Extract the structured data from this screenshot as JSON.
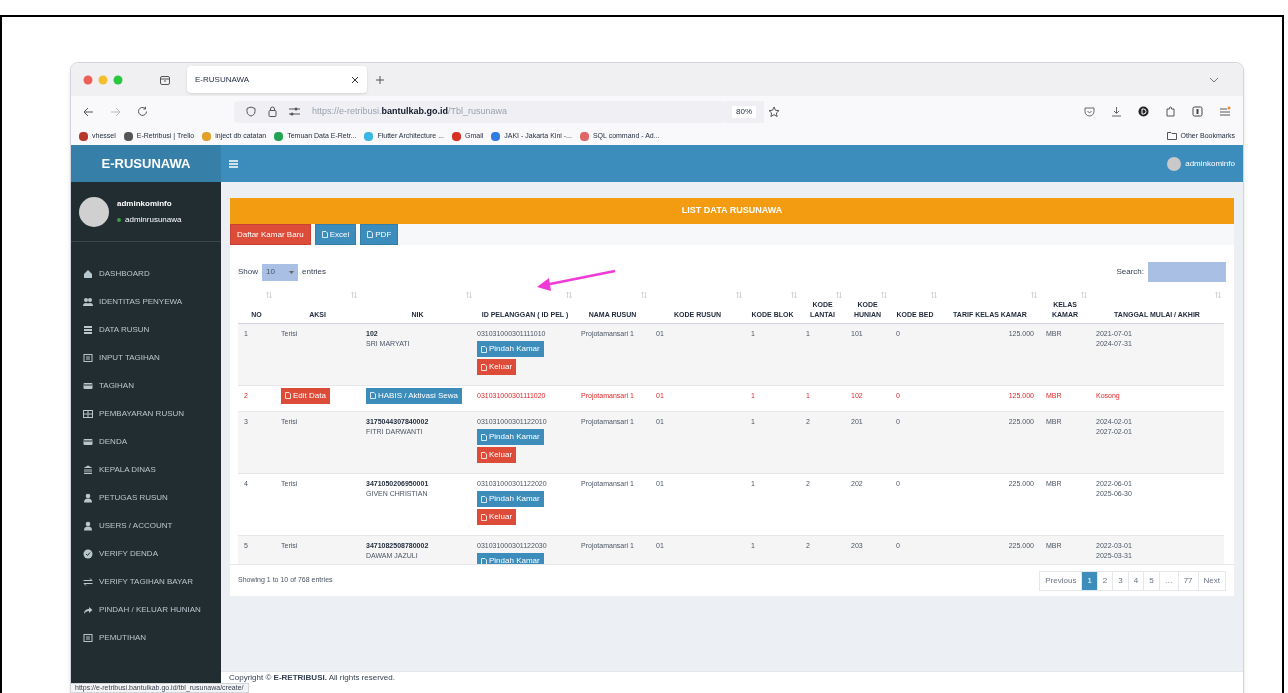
{
  "browser": {
    "tab_title": "E-RUSUNAWA",
    "url": "https://e-retribusi.**bantulkab.go.id**/Tbl_rusunawa",
    "zoom": "80%",
    "bookmarks": [
      {
        "label": "vhessel",
        "color": "#b7372b"
      },
      {
        "label": "E-Retribusi | Trello",
        "color": "#555555"
      },
      {
        "label": "inject db catatan",
        "color": "#e0a02a"
      },
      {
        "label": "Temuan Data E-Retr...",
        "color": "#23a455"
      },
      {
        "label": "Flutter Architecture ...",
        "color": "#3cb6e3"
      },
      {
        "label": "Gmail",
        "color": "#d93025"
      },
      {
        "label": "JAKI - Jakarta Kini -...",
        "color": "#2f7de1"
      },
      {
        "label": "SQL command - Ad...",
        "color": "#e06666"
      }
    ],
    "other_bookmarks": "Other Bookmarks",
    "status_url": "https://e-retribusi.bantulkab.go.id/tbl_rusunawa/create/"
  },
  "app": {
    "brand": "E-RUSUNAWA",
    "header_user": "adminkominfo"
  },
  "sidebar": {
    "user": {
      "name": "adminkominfo",
      "role": "adminrusunawa"
    },
    "items": [
      {
        "label": "DASHBOARD",
        "kind": "home"
      },
      {
        "label": "IDENTITAS PENYEWA",
        "kind": "users"
      },
      {
        "label": "DATA RUSUN",
        "kind": "database"
      },
      {
        "label": "INPUT TAGIHAN",
        "kind": "list"
      },
      {
        "label": "TAGIHAN",
        "kind": "card"
      },
      {
        "label": "PEMBAYARAN RUSUN",
        "kind": "grid"
      },
      {
        "label": "DENDA",
        "kind": "card"
      },
      {
        "label": "KEPALA DINAS",
        "kind": "building"
      },
      {
        "label": "PETUGAS RUSUN",
        "kind": "user"
      },
      {
        "label": "USERS / ACCOUNT",
        "kind": "user"
      },
      {
        "label": "VERIFY DENDA",
        "kind": "check"
      },
      {
        "label": "VERIFY TAGIHAN BAYAR",
        "kind": "exchange"
      },
      {
        "label": "PINDAH / KELUAR HUNIAN",
        "kind": "share"
      },
      {
        "label": "PEMUTIHAN",
        "kind": "list"
      }
    ]
  },
  "panel": {
    "title": "LIST DATA RUSUNAWA",
    "buttons": [
      {
        "label": "Daftar Kamar Baru",
        "kind": "danger"
      },
      {
        "label": "Excel",
        "kind": "primary"
      },
      {
        "label": "PDF",
        "kind": "primary"
      }
    ],
    "show_label": "Show",
    "page_size": "10",
    "entries_label": "entries",
    "search_label": "Search:",
    "columns": [
      "NO",
      "AKSI",
      "NIK",
      "ID PELANGGAN ( ID PEL )",
      "NAMA RUSUN",
      "KODE RUSUN",
      "KODE BLOK",
      "KODE LANTAI",
      "KODE HUNIAN",
      "KODE BED",
      "TARIF KELAS KAMAR",
      "KELAS KAMAR",
      "TANGGAL MULAI / AKHIR"
    ],
    "rows": [
      {
        "kind": "occupied",
        "no": "1",
        "aksi": "Terisi",
        "nik": "102",
        "name": "SRI MARYATI",
        "id_pel": "031031000301111010",
        "actions": [
          {
            "label": "Pindah Kamar",
            "kind": "move"
          },
          {
            "label": "Keluar",
            "kind": "exit"
          }
        ],
        "nama_rusun": "Projotamansari 1",
        "kode_rusun": "01",
        "blok": "1",
        "lantai": "1",
        "hunian": "101",
        "bed": "0",
        "tarif": "125.000",
        "kelas": "MBR",
        "dates": [
          "2021-07-01",
          "2024-07-31"
        ]
      },
      {
        "kind": "empty",
        "no": "2",
        "aksi_button": "Edit Data",
        "nik_button": "HABIS / Aktivasi Sewa",
        "id_pel": "031031000301111020",
        "nama_rusun": "Projotamansari 1",
        "kode_rusun": "01",
        "blok": "1",
        "lantai": "1",
        "hunian": "102",
        "bed": "0",
        "tarif": "125.000",
        "kelas": "MBR",
        "dates": [
          "Kosong"
        ]
      },
      {
        "kind": "occupied",
        "no": "3",
        "aksi": "Terisi",
        "nik": "3175044307840002",
        "name": "FITRI DARWANTI",
        "id_pel": "031031000301122010",
        "actions": [
          {
            "label": "Pindah Kamar",
            "kind": "move"
          },
          {
            "label": "Keluar",
            "kind": "exit"
          }
        ],
        "nama_rusun": "Projotamansari 1",
        "kode_rusun": "01",
        "blok": "1",
        "lantai": "2",
        "hunian": "201",
        "bed": "0",
        "tarif": "225.000",
        "kelas": "MBR",
        "dates": [
          "2024-02-01",
          "2027-02-01"
        ]
      },
      {
        "kind": "occupied",
        "no": "4",
        "aksi": "Terisi",
        "nik": "3471050206950001",
        "name": "GIVEN CHRISTIAN",
        "id_pel": "031031000301122020",
        "actions": [
          {
            "label": "Pindah Kamar",
            "kind": "move"
          },
          {
            "label": "Keluar",
            "kind": "exit"
          }
        ],
        "nama_rusun": "Projotamansari 1",
        "kode_rusun": "01",
        "blok": "1",
        "lantai": "2",
        "hunian": "202",
        "bed": "0",
        "tarif": "225.000",
        "kelas": "MBR",
        "dates": [
          "2022-06-01",
          "2025-06-30"
        ]
      },
      {
        "kind": "occupied",
        "no": "5",
        "aksi": "Terisi",
        "nik": "3471082508780002",
        "name": "DAWAM JAZULI",
        "id_pel": "031031000301122030",
        "actions": [
          {
            "label": "Pindah Kamar",
            "kind": "move"
          }
        ],
        "nama_rusun": "Projotamansari 1",
        "kode_rusun": "01",
        "blok": "1",
        "lantai": "2",
        "hunian": "203",
        "bed": "0",
        "tarif": "225.000",
        "kelas": "MBR",
        "dates": [
          "2022-03-01",
          "2025-03-31"
        ]
      }
    ],
    "info": "Showing 1 to 10 of 768 entries",
    "pages": [
      {
        "label": "Previous",
        "selected": false
      },
      {
        "label": "1",
        "selected": true
      },
      {
        "label": "2",
        "selected": false
      },
      {
        "label": "3",
        "selected": false
      },
      {
        "label": "4",
        "selected": false
      },
      {
        "label": "5",
        "selected": false
      },
      {
        "label": "…",
        "selected": false
      },
      {
        "label": "77",
        "selected": false
      },
      {
        "label": "Next",
        "selected": false
      }
    ]
  },
  "footer": {
    "text": "Copyright © **E-RETRIBUSI.** All rights reserved."
  }
}
